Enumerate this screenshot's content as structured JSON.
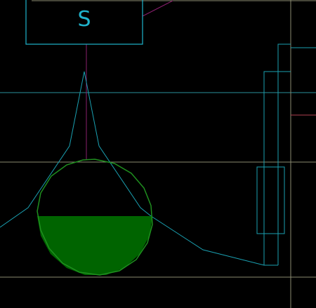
{
  "block": {
    "label": "S"
  },
  "colors": {
    "background": "#000000",
    "cyan_line": "#1a9fb0",
    "block_border": "#1fb3cc",
    "block_label": "#1fb3cc",
    "guide_line": "#8a8a70",
    "magenta_line": "#8a1f6e",
    "red_line": "#b04050",
    "sphere_outline": "#1f8f1f",
    "liquid_fill": "#006400"
  },
  "liquid_level_fraction": 0.53
}
